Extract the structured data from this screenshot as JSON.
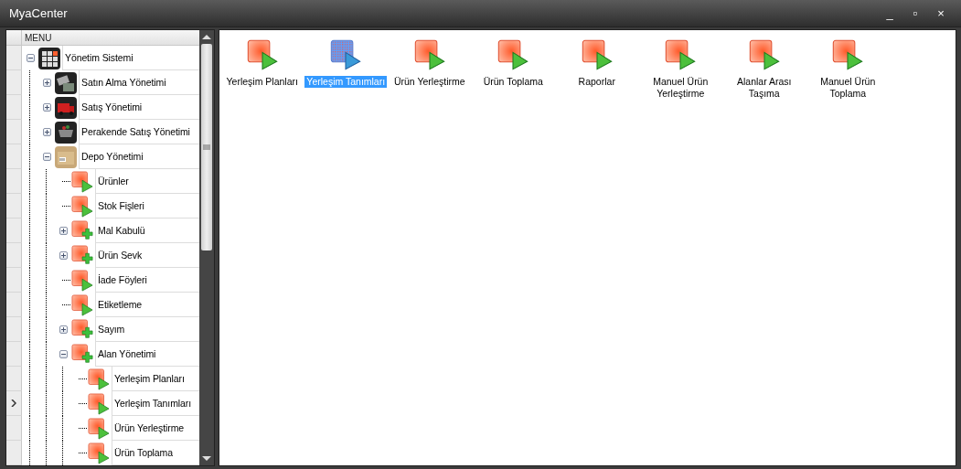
{
  "window": {
    "title": "MyaCenter",
    "controls": [
      "_",
      "▫",
      "×"
    ]
  },
  "menu": {
    "header": "MENU",
    "tree": [
      {
        "label": "Yönetim Sistemi",
        "kind": "grid",
        "expanded": true,
        "selected": false,
        "children": [
          {
            "label": "Satın Alma Yönetimi",
            "kind": "tags",
            "expanded": false,
            "selected": false
          },
          {
            "label": "Satış Yönetimi",
            "kind": "truck",
            "expanded": false,
            "selected": false
          },
          {
            "label": "Perakende Satış Yönetimi",
            "kind": "basket",
            "expanded": false,
            "selected": false
          },
          {
            "label": "Depo Yönetimi",
            "kind": "box",
            "expanded": true,
            "selected": false,
            "children": [
              {
                "label": "Ürünler",
                "kind": "form",
                "selected": false
              },
              {
                "label": "Stok Fişleri",
                "kind": "form",
                "selected": false
              },
              {
                "label": "Mal Kabulü",
                "kind": "module",
                "expanded": false,
                "selected": false
              },
              {
                "label": "Ürün Sevk",
                "kind": "module",
                "expanded": false,
                "selected": false
              },
              {
                "label": "İade Föyleri",
                "kind": "form",
                "selected": false
              },
              {
                "label": "Etiketleme",
                "kind": "form",
                "selected": false
              },
              {
                "label": "Sayım",
                "kind": "module",
                "expanded": false,
                "selected": false
              },
              {
                "label": "Alan Yönetimi",
                "kind": "module",
                "expanded": true,
                "selected": false,
                "children": [
                  {
                    "label": "Yerleşim Planları",
                    "kind": "form",
                    "selected": false
                  },
                  {
                    "label": "Yerleşim Tanımları",
                    "kind": "form",
                    "selected": true
                  },
                  {
                    "label": "Ürün Yerleştirme",
                    "kind": "form",
                    "selected": false
                  },
                  {
                    "label": "Ürün Toplama",
                    "kind": "form",
                    "selected": false
                  }
                ]
              }
            ]
          }
        ]
      }
    ]
  },
  "items": [
    {
      "label": "Yerleşim Planları",
      "selected": false
    },
    {
      "label": "Yerleşim Tanımları",
      "selected": true
    },
    {
      "label": "Ürün Yerleştirme",
      "selected": false
    },
    {
      "label": "Ürün Toplama",
      "selected": false
    },
    {
      "label": "Raporlar",
      "selected": false
    },
    {
      "label": "Manuel Ürün Yerleştirme",
      "selected": false
    },
    {
      "label": "Alanlar Arası Taşıma",
      "selected": false
    },
    {
      "label": "Manuel Ürün Toplama",
      "selected": false
    }
  ]
}
